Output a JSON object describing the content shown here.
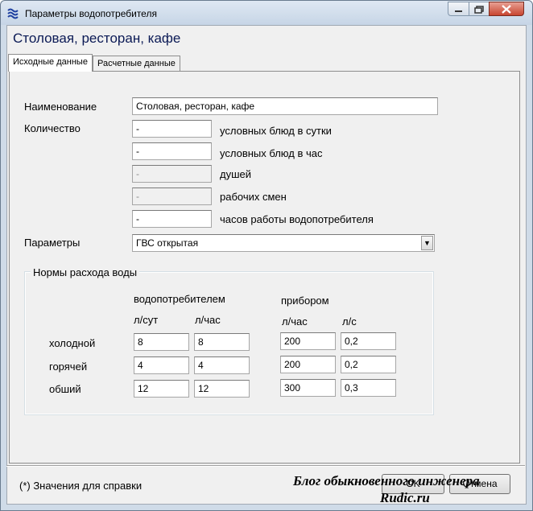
{
  "window": {
    "title": "Параметры водопотребителя"
  },
  "heading": "Столовая, ресторан, кафе",
  "tabs": [
    {
      "label": "Исходные данные",
      "active": true
    },
    {
      "label": "Расчетные данные",
      "active": false
    }
  ],
  "form": {
    "name_label": "Наименование",
    "name_value": "Столовая, ресторан, кафе",
    "qty_label": "Количество",
    "qty_rows": [
      {
        "value": "-",
        "unit": "условных блюд в сутки",
        "enabled": true
      },
      {
        "value": "-",
        "unit": "условных блюд в час",
        "enabled": true
      },
      {
        "value": "-",
        "unit": "душей",
        "enabled": false
      },
      {
        "value": "-",
        "unit": "рабочих смен",
        "enabled": false
      },
      {
        "value": "-",
        "unit": "часов работы водопотребителя",
        "enabled": true
      }
    ],
    "params_label": "Параметры",
    "params_value": "ГВС открытая"
  },
  "norms": {
    "title": "Нормы расхода воды",
    "group_consumer": "водопотребителем",
    "group_device": "прибором",
    "columns": [
      "л/сут",
      "л/час",
      "л/час",
      "л/с"
    ],
    "rows": [
      {
        "label": "холодной",
        "values": [
          "8",
          "8",
          "200",
          "0,2"
        ]
      },
      {
        "label": "горячей",
        "values": [
          "4",
          "4",
          "200",
          "0,2"
        ]
      },
      {
        "label": "обший",
        "values": [
          "12",
          "12",
          "300",
          "0,3"
        ]
      }
    ]
  },
  "footer": {
    "note": "(*) Значения для справки",
    "ok_label": "OK",
    "cancel_label": "Отмена"
  },
  "watermark": {
    "line1": "Блог обыкновенного инженера",
    "line2": "Rudic.ru"
  },
  "colors": {
    "heading": "#0b1a55",
    "titlebar": "#c6d5e6",
    "close_button": "#c84530"
  }
}
